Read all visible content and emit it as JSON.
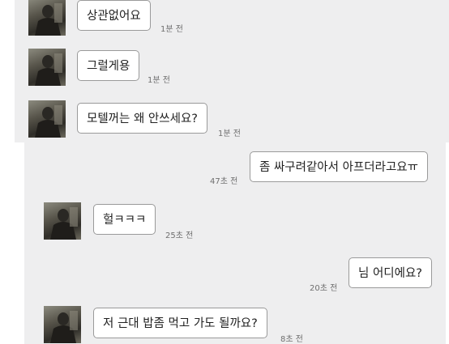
{
  "chat": {
    "messages": [
      {
        "sender": "partner",
        "text": "상관없어요",
        "time": "1분 전"
      },
      {
        "sender": "partner",
        "text": "그럴게용",
        "time": "1분 전"
      },
      {
        "sender": "partner",
        "text": "모텔꺼는 왜 안쓰세요?",
        "time": "1분 전"
      },
      {
        "sender": "me",
        "text": "좀 싸구려같아서 아프더라고요ㅠ",
        "time": "47초 전"
      },
      {
        "sender": "partner",
        "text": "헐ㅋㅋㅋ",
        "time": "25초 전"
      },
      {
        "sender": "me",
        "text": "님 어디에요?",
        "time": "20초 전"
      },
      {
        "sender": "partner",
        "text": "저 근대 밥좀 먹고 가도 될까요?",
        "time": "8초 전"
      }
    ]
  }
}
